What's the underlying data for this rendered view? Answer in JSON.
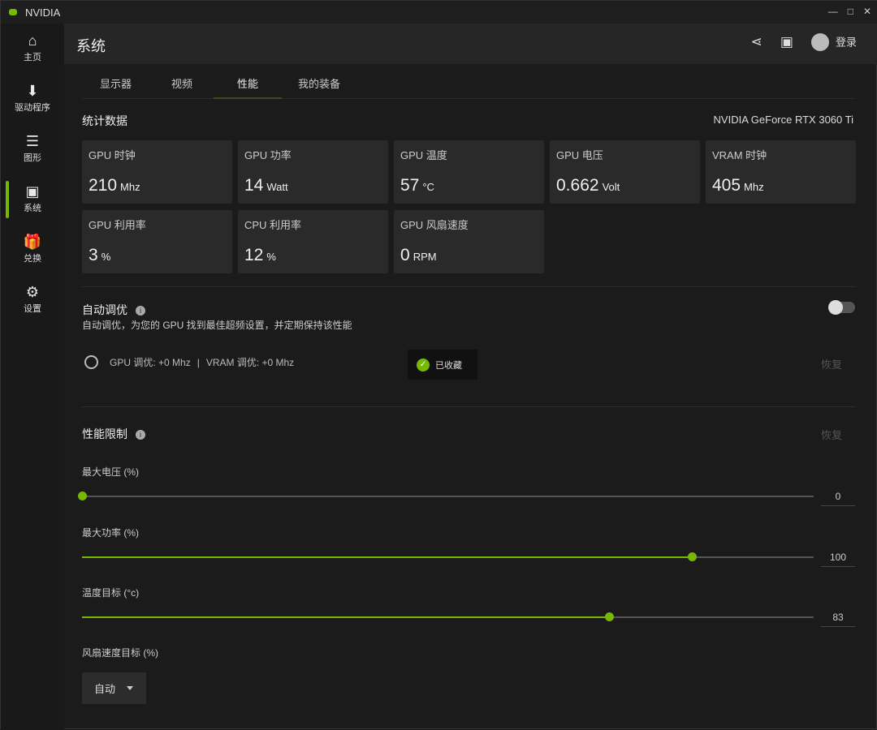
{
  "app": {
    "title": "NVIDIA",
    "window_controls": [
      "—",
      "□",
      "✕"
    ]
  },
  "sidebar": {
    "items": [
      {
        "label": "主页",
        "icon": "home-icon",
        "glyph": "⌂"
      },
      {
        "label": "驱动程序",
        "icon": "driver-download-icon",
        "glyph": "⬇"
      },
      {
        "label": "图形",
        "icon": "sliders-icon",
        "glyph": "☰"
      },
      {
        "label": "系统",
        "icon": "system-icon",
        "glyph": "▣"
      },
      {
        "label": "兑换",
        "icon": "gift-icon",
        "glyph": "🎁"
      },
      {
        "label": "设置",
        "icon": "gear-icon",
        "glyph": "⚙"
      }
    ],
    "active": "系统"
  },
  "header": {
    "title": "系统",
    "login": "登录"
  },
  "tabs": [
    {
      "label": "显示器"
    },
    {
      "label": "视频"
    },
    {
      "label": "性能",
      "active": true
    },
    {
      "label": "我的装备"
    }
  ],
  "stats": {
    "title": "统计数据",
    "gpu_name": "NVIDIA GeForce RTX 3060 Ti",
    "cards": [
      {
        "label": "GPU 时钟",
        "value": "210",
        "unit": "Mhz"
      },
      {
        "label": "GPU 功率",
        "value": "14",
        "unit": "Watt"
      },
      {
        "label": "GPU 温度",
        "value": "57",
        "unit": "°C"
      },
      {
        "label": "GPU 电压",
        "value": "0.662",
        "unit": "Volt"
      },
      {
        "label": "VRAM 时钟",
        "value": "405",
        "unit": "Mhz"
      },
      {
        "label": "GPU 利用率",
        "value": "3",
        "unit": "%"
      },
      {
        "label": "CPU 利用率",
        "value": "12",
        "unit": "%"
      },
      {
        "label": "GPU 风扇速度",
        "value": "0",
        "unit": "RPM"
      }
    ]
  },
  "autotune": {
    "title": "自动调优",
    "description": "自动调优，为您的 GPU 找到最佳超频设置，并定期保持该性能",
    "enabled": false,
    "gpu_oc": "GPU 调优:  +0 Mhz",
    "sep": "|",
    "vram_oc": "VRAM 调优:  +0 Mhz",
    "toast": "已收藏",
    "reset": "恢复"
  },
  "limits": {
    "title": "性能限制",
    "reset": "恢复",
    "sliders": [
      {
        "label": "最大电压 (%)",
        "value": 0,
        "min": 0,
        "max": 100
      },
      {
        "label": "最大功率 (%)",
        "value": 100,
        "min": 0,
        "max": 120
      },
      {
        "label": "温度目标 (°c)",
        "value": 83,
        "min": 65,
        "max": 90
      }
    ],
    "fan": {
      "label": "风扇速度目标 (%)",
      "selected": "自动"
    }
  },
  "colors": {
    "accent": "#76b900"
  }
}
